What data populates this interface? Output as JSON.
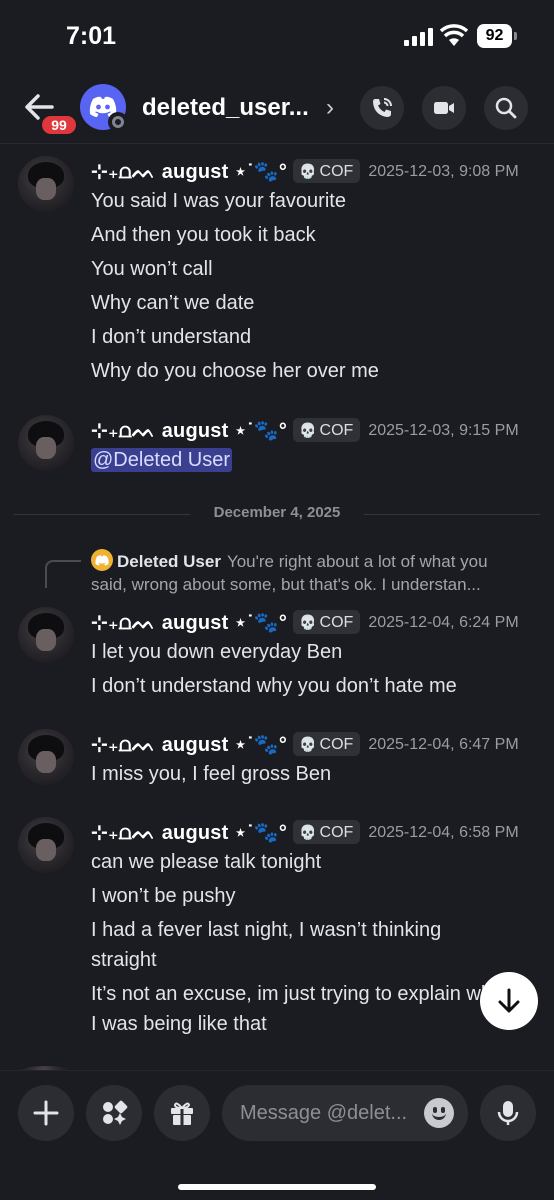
{
  "status": {
    "time": "7:01",
    "battery": "92"
  },
  "header": {
    "badge_count": "99",
    "title": "deleted_user...",
    "chevron": "›"
  },
  "messages": [
    {
      "username": "⊹₊⩍ᨓ august ⋆˙🐾°",
      "tag": "COF",
      "timestamp": "2025-12-03, 9:08 PM",
      "lines": [
        "You said I was your favourite",
        "And then you took it back",
        "You won’t call",
        "Why can’t we date",
        "I don’t understand",
        "Why do you choose her over me"
      ]
    },
    {
      "username": "⊹₊⩍ᨓ august ⋆˙🐾°",
      "tag": "COF",
      "timestamp": "2025-12-03, 9:15 PM",
      "mention": "@Deleted User"
    },
    {
      "username": "⊹₊⩍ᨓ august ⋆˙🐾°",
      "tag": "COF",
      "timestamp": "2025-12-04, 6:24 PM",
      "lines": [
        "I let you down everyday Ben",
        "I don’t understand why you don’t hate me"
      ]
    },
    {
      "username": "⊹₊⩍ᨓ august ⋆˙🐾°",
      "tag": "COF",
      "timestamp": "2025-12-04, 6:47 PM",
      "lines": [
        "I miss you, I feel gross Ben"
      ]
    },
    {
      "username": "⊹₊⩍ᨓ august ⋆˙🐾°",
      "tag": "COF",
      "timestamp": "2025-12-04, 6:58 PM",
      "lines": [
        "can we please talk tonight",
        "I won’t be pushy",
        "I had a fever last night, I wasn’t thinking",
        "straight",
        "It’s not an excuse, im just trying to explain why",
        "I was being like that"
      ]
    }
  ],
  "date_divider": "December 4, 2025",
  "reply": {
    "name": "Deleted User",
    "text_line1": "You're right about a lot of what you",
    "text_line2": "said, wrong about some, but that's ok. I understan..."
  },
  "composer": {
    "placeholder": "Message @delet..."
  },
  "icons": {
    "back": "arrow-left-icon",
    "discord": "discord-logo-icon",
    "call": "phone-icon",
    "video": "video-camera-icon",
    "search": "search-icon",
    "plus": "plus-icon",
    "apps": "apps-icon",
    "gift": "gift-icon",
    "emoji": "emoji-icon",
    "mic": "microphone-icon",
    "scroll_down": "arrow-down-icon",
    "skull": "skull-icon"
  },
  "colors": {
    "background": "#1b1c21",
    "blurple": "#5865f2",
    "badge": "#e0373c",
    "mention_bg": "#3b3f8f"
  }
}
